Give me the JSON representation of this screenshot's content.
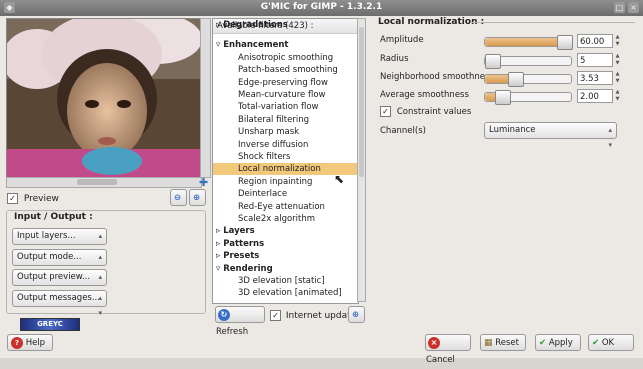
{
  "window": {
    "title": "G'MIC for GIMP - 1.3.2.1"
  },
  "preview": {
    "checkbox_label": "Preview",
    "checked": true
  },
  "io": {
    "group_label": "Input / Output :",
    "input_layers": "Input layers...",
    "output_mode": "Output mode...",
    "output_preview": "Output preview...",
    "output_messages": "Output messages..."
  },
  "logo": {
    "text": "GREYC"
  },
  "filters": {
    "header": "Available filters (423) :",
    "rows": [
      {
        "label": "Degradations",
        "kind": "cat-collapsed"
      },
      {
        "label": "Enhancement",
        "kind": "cat-open"
      },
      {
        "label": "Anisotropic smoothing",
        "kind": "item"
      },
      {
        "label": "Patch-based smoothing",
        "kind": "item"
      },
      {
        "label": "Edge-preserving flow",
        "kind": "item"
      },
      {
        "label": "Mean-curvature flow",
        "kind": "item"
      },
      {
        "label": "Total-variation flow",
        "kind": "item"
      },
      {
        "label": "Bilateral filtering",
        "kind": "item"
      },
      {
        "label": "Unsharp mask",
        "kind": "item"
      },
      {
        "label": "Inverse diffusion",
        "kind": "item"
      },
      {
        "label": "Shock filters",
        "kind": "item"
      },
      {
        "label": "Local normalization",
        "kind": "selected"
      },
      {
        "label": "Region inpainting",
        "kind": "item"
      },
      {
        "label": "Deinterlace",
        "kind": "item"
      },
      {
        "label": "Red-Eye attenuation",
        "kind": "item"
      },
      {
        "label": "Scale2x algorithm",
        "kind": "item"
      },
      {
        "label": "Layers",
        "kind": "cat-collapsed"
      },
      {
        "label": "Patterns",
        "kind": "cat-collapsed"
      },
      {
        "label": "Presets",
        "kind": "cat-collapsed"
      },
      {
        "label": "Rendering",
        "kind": "cat-open"
      },
      {
        "label": "3D elevation [static]",
        "kind": "item"
      },
      {
        "label": "3D elevation [animated]",
        "kind": "item"
      }
    ],
    "refresh_label": "Refresh",
    "internet_updates_label": "Internet updates",
    "internet_updates_checked": true
  },
  "params": {
    "title": "Local normalization :",
    "rows": [
      {
        "label": "Amplitude",
        "value": "60.00",
        "fraction": 1.0
      },
      {
        "label": "Radius",
        "value": "5",
        "fraction": 0.05
      },
      {
        "label": "Neighborhood smoothness",
        "value": "3.53",
        "fraction": 0.35
      },
      {
        "label": "Average smoothness",
        "value": "2.00",
        "fraction": 0.2
      }
    ],
    "constraint_label": "Constraint values",
    "constraint_checked": true,
    "channels_label": "Channel(s)",
    "channels_value": "Luminance"
  },
  "footer": {
    "help": "Help",
    "cancel": "Cancel",
    "reset": "Reset",
    "apply": "Apply",
    "ok": "OK"
  }
}
